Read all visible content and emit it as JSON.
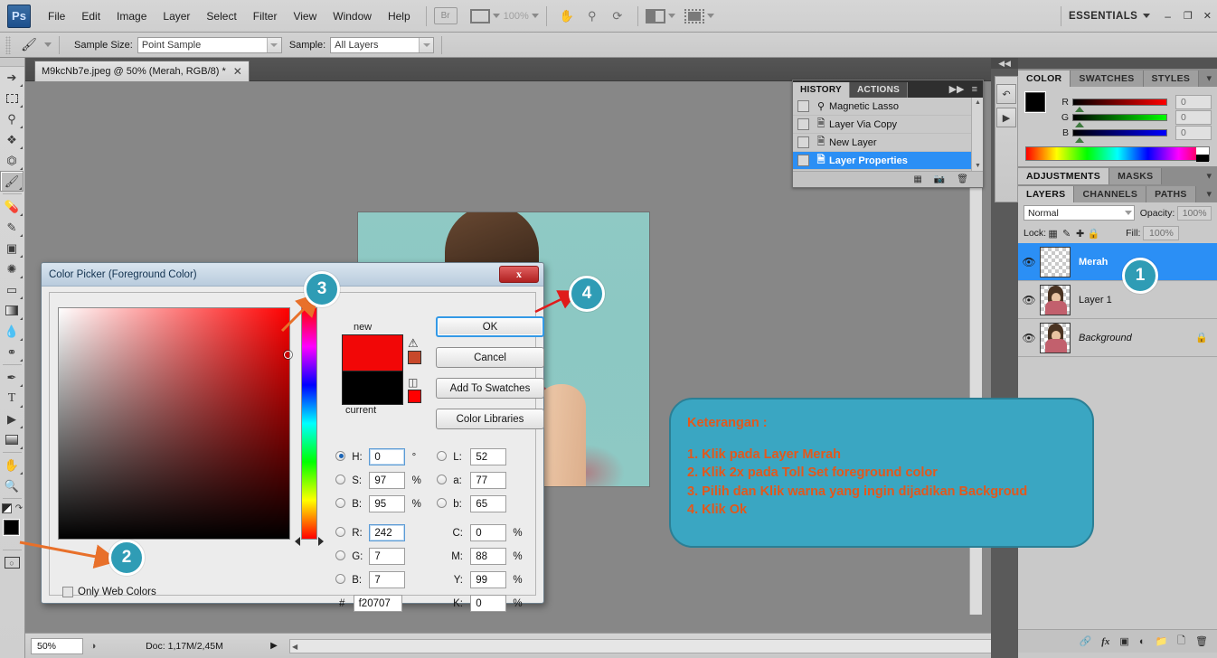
{
  "app": {
    "logo": "Ps",
    "workspace": "ESSENTIALS",
    "zoom_level": "100%",
    "window_controls": {
      "minimize": "–",
      "restore": "❐",
      "close": "✕"
    }
  },
  "menu": {
    "items": [
      "File",
      "Edit",
      "Image",
      "Layer",
      "Select",
      "Filter",
      "View",
      "Window",
      "Help"
    ],
    "bridge_label": "Br"
  },
  "options_bar": {
    "tool_icon": "eyedropper-icon",
    "sample_size_label": "Sample Size:",
    "sample_size_value": "Point Sample",
    "sample_label": "Sample:",
    "sample_value": "All Layers"
  },
  "toolbox": {
    "tools": [
      "move-icon",
      "marquee-icon",
      "lasso-icon",
      "quick-select-icon",
      "crop-icon",
      "eyedropper-icon",
      "healing-brush-icon",
      "brush-icon",
      "clone-stamp-icon",
      "history-brush-icon",
      "eraser-icon",
      "gradient-icon",
      "blur-icon",
      "dodge-icon",
      "pen-icon",
      "type-icon",
      "path-select-icon",
      "shape-icon",
      "hand-icon",
      "zoom-icon"
    ],
    "type_glyph": "T",
    "selected_tool": "eyedropper-icon",
    "foreground_color": "#000000",
    "background_color": "#ffffff",
    "quick_mask_label": "quick-mask-icon"
  },
  "document": {
    "tab_title": "M9kcNb7e.jpeg @ 50% (Merah, RGB/8) *",
    "close_glyph": "✕"
  },
  "status_bar": {
    "zoom": "50%",
    "doc_info": "Doc: 1,17M/2,45M"
  },
  "history_panel": {
    "tabs": [
      "HISTORY",
      "ACTIONS"
    ],
    "active_tab": "HISTORY",
    "collapse_glyph": "▶▶",
    "menu_glyph": "≡",
    "items": [
      {
        "label": "Magnetic Lasso",
        "icon": "lasso-state-icon",
        "selected": false
      },
      {
        "label": "Layer Via Copy",
        "icon": "layer-state-icon",
        "selected": false
      },
      {
        "label": "New Layer",
        "icon": "layer-state-icon",
        "selected": false
      },
      {
        "label": "Layer Properties",
        "icon": "layer-state-icon",
        "selected": true
      }
    ],
    "footer_icons": [
      "new-document-icon",
      "new-snapshot-icon",
      "delete-icon"
    ]
  },
  "color_panel": {
    "tabs": [
      "COLOR",
      "SWATCHES",
      "STYLES"
    ],
    "active_tab": "COLOR",
    "channels": [
      {
        "label": "R",
        "value": "0"
      },
      {
        "label": "G",
        "value": "0"
      },
      {
        "label": "B",
        "value": "0"
      }
    ],
    "foreground_color": "#000000",
    "background_color": "#ffffff"
  },
  "adjustments_panel": {
    "tabs": [
      "ADJUSTMENTS",
      "MASKS"
    ],
    "active_tab": "ADJUSTMENTS"
  },
  "layers_panel": {
    "tabs": [
      "LAYERS",
      "CHANNELS",
      "PATHS"
    ],
    "active_tab": "LAYERS",
    "blend_mode": "Normal",
    "opacity_label": "Opacity:",
    "opacity_value": "100%",
    "lock_label": "Lock:",
    "lock_icons": [
      "lock-transparency-icon",
      "lock-image-icon",
      "lock-position-icon",
      "lock-all-icon"
    ],
    "fill_label": "Fill:",
    "fill_value": "100%",
    "layers": [
      {
        "name": "Merah",
        "selected": true,
        "visible": true,
        "locked": false,
        "thumb": "transparent"
      },
      {
        "name": "Layer 1",
        "selected": false,
        "visible": true,
        "locked": false,
        "thumb": "cutout"
      },
      {
        "name": "Background",
        "selected": false,
        "visible": true,
        "locked": true,
        "thumb": "photo"
      }
    ],
    "footer_icons": [
      "link-layers-icon",
      "layer-style-icon",
      "layer-mask-icon",
      "adjustment-layer-icon",
      "new-group-icon",
      "new-layer-icon",
      "delete-layer-icon"
    ],
    "fx_glyph": "fx"
  },
  "color_picker": {
    "title": "Color Picker (Foreground Color)",
    "close_glyph": "✕",
    "new_label": "new",
    "current_label": "current",
    "new_color": "#f20707",
    "current_color": "#000000",
    "out_of_gamut_icon": "warning-icon",
    "out_of_gamut_chip": "#c8482a",
    "non_web_safe_icon": "cube-icon",
    "non_web_safe_chip": "#ff0000",
    "buttons": [
      {
        "label": "OK",
        "primary": true
      },
      {
        "label": "Cancel",
        "primary": false
      },
      {
        "label": "Add To Swatches",
        "primary": false
      },
      {
        "label": "Color Libraries",
        "primary": false
      }
    ],
    "only_web_colors_label": "Only Web Colors",
    "only_web_colors_checked": false,
    "hsb": [
      {
        "label": "H:",
        "value": "0",
        "unit": "°",
        "selected": true
      },
      {
        "label": "S:",
        "value": "97",
        "unit": "%",
        "selected": false
      },
      {
        "label": "B:",
        "value": "95",
        "unit": "%",
        "selected": false
      }
    ],
    "rgb": [
      {
        "label": "R:",
        "value": "242",
        "unit": "",
        "selected": false,
        "focused": true
      },
      {
        "label": "G:",
        "value": "7",
        "unit": "",
        "selected": false,
        "focused": false
      },
      {
        "label": "B:",
        "value": "7",
        "unit": "",
        "selected": false,
        "focused": false
      }
    ],
    "lab": [
      {
        "label": "L:",
        "value": "52",
        "unit": "",
        "selected": false
      },
      {
        "label": "a:",
        "value": "77",
        "unit": "",
        "selected": false
      },
      {
        "label": "b:",
        "value": "65",
        "unit": "",
        "selected": false
      }
    ],
    "cmyk": [
      {
        "label": "C:",
        "value": "0",
        "unit": "%"
      },
      {
        "label": "M:",
        "value": "88",
        "unit": "%"
      },
      {
        "label": "Y:",
        "value": "99",
        "unit": "%"
      },
      {
        "label": "K:",
        "value": "0",
        "unit": "%"
      }
    ],
    "hex_label": "#",
    "hex_value": "f20707"
  },
  "callouts": [
    {
      "number": "1",
      "target": "layer-merah"
    },
    {
      "number": "2",
      "target": "foreground-color-swatch"
    },
    {
      "number": "3",
      "target": "color-field"
    },
    {
      "number": "4",
      "target": "ok-button"
    }
  ],
  "annotation": {
    "heading": "Keterangan :",
    "lines": [
      "1. Klik pada Layer Merah",
      "2. Klik 2x  pada Toll Set foreground color",
      "3. Pilih dan Klik warna yang ingin dijadikan Backgroud",
      "4. Klik Ok"
    ],
    "bg_color": "#3aa6c2",
    "text_color": "#e2581c"
  },
  "colors": {
    "accent_callout": "#2f9cb5",
    "selection_blue": "#2b8ff5",
    "arrow_orange": "#e8702a",
    "arrow_red": "#e01b1b"
  }
}
